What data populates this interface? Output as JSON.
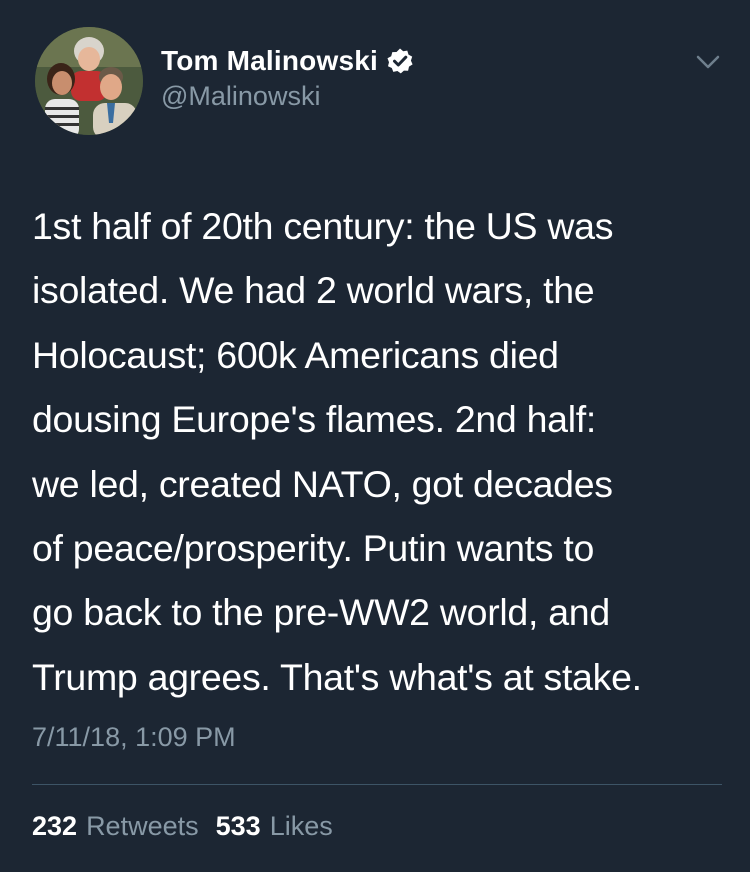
{
  "tweet": {
    "author": {
      "display_name": "Tom Malinowski",
      "handle": "@Malinowski",
      "verified_icon": "verified-badge-icon",
      "avatar": "profile-photo"
    },
    "menu_icon": "chevron-down-icon",
    "text": "1st half of 20th century: the US was\nisolated. We had 2 world wars, the\nHolocaust; 600k Americans died\ndousing Europe's flames. 2nd half:\nwe led, created NATO, got decades\nof peace/prosperity. Putin wants to\ngo back to the pre-WW2 world, and\nTrump agrees. That's what's at stake.",
    "timestamp": "7/11/18, 1:09 PM",
    "stats": {
      "retweets_count": "232",
      "retweets_label": "Retweets",
      "likes_count": "533",
      "likes_label": "Likes"
    }
  },
  "colors": {
    "background": "#1c2633",
    "primary_text": "#ffffff",
    "secondary_text": "#8899a6",
    "verified_badge": "#ffffff",
    "divider": "#3d5466"
  }
}
